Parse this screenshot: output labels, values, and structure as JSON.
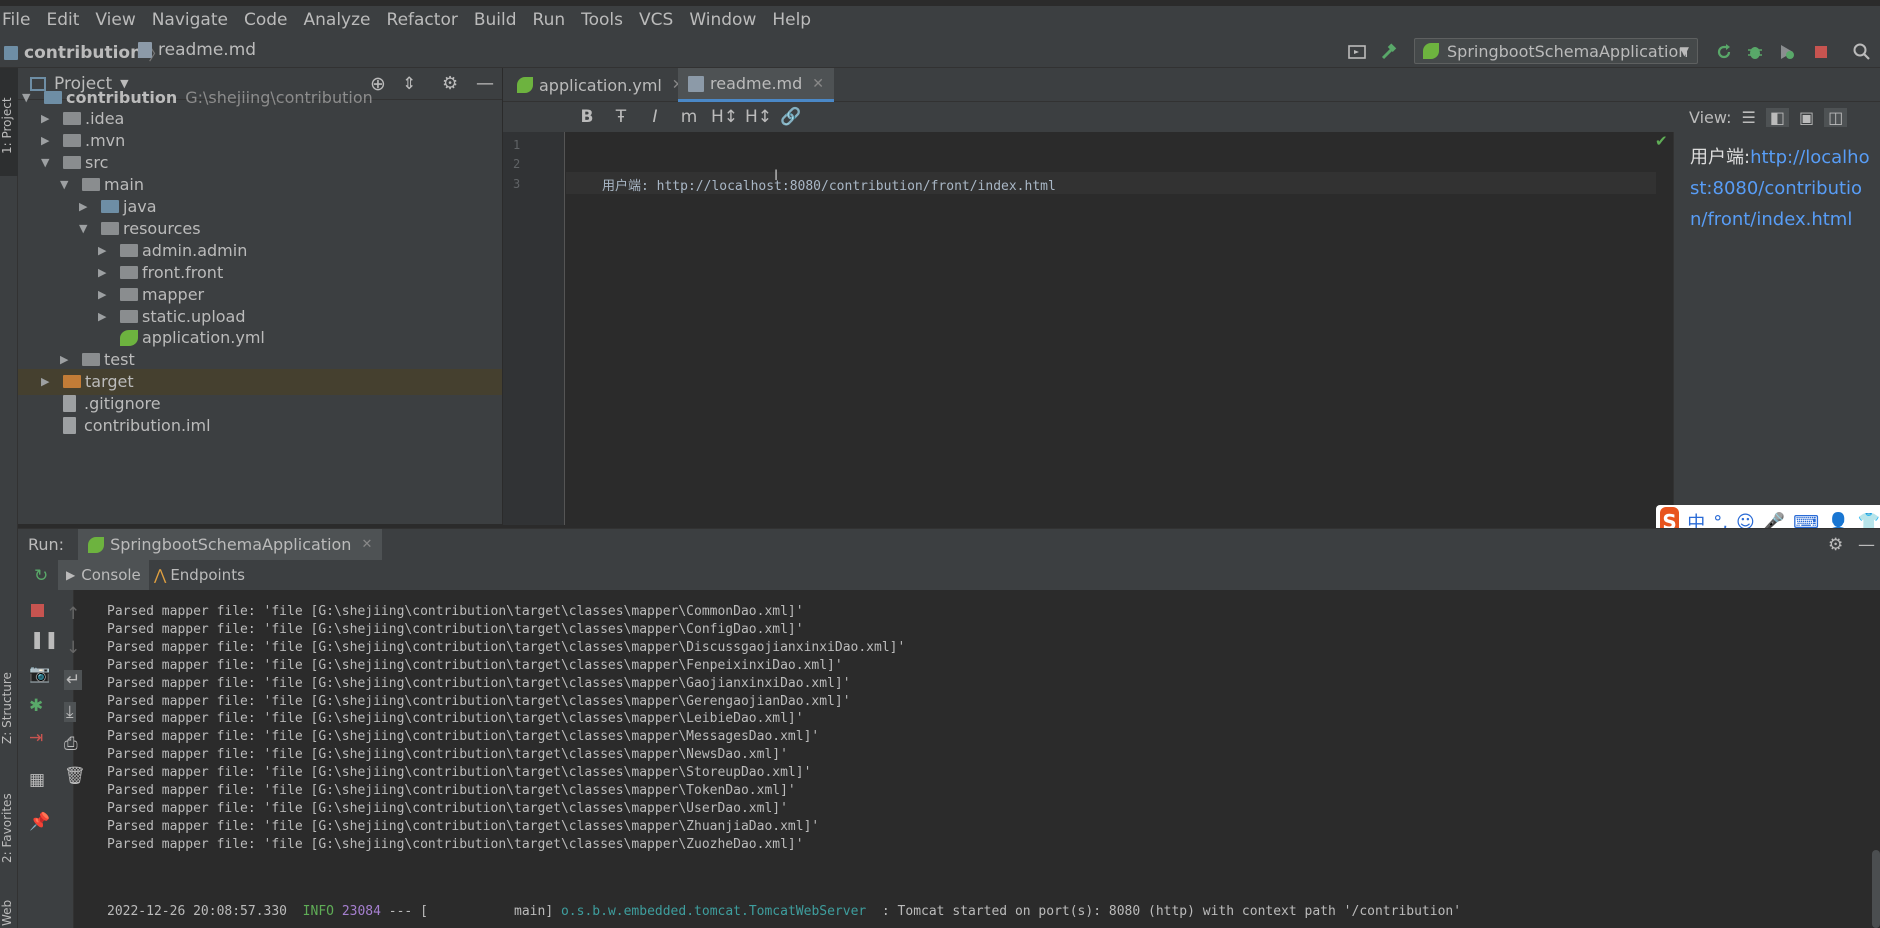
{
  "menu": [
    "File",
    "Edit",
    "View",
    "Navigate",
    "Code",
    "Analyze",
    "Refactor",
    "Build",
    "Run",
    "Tools",
    "VCS",
    "Window",
    "Help"
  ],
  "breadcrumb": {
    "project": "contribution",
    "file": "readme.md"
  },
  "run_config": "SpringbootSchemaApplication",
  "left_stripe": {
    "project": "1: Project",
    "structure": "Z: Structure",
    "favorites": "2: Favorites",
    "web": "Web"
  },
  "project_panel": {
    "title": "Project",
    "tree": [
      {
        "label": "contribution",
        "path": "G:\\shejiing\\contribution",
        "arrow": "▼",
        "indent": 0,
        "kind": "module"
      },
      {
        "label": ".idea",
        "arrow": "▶",
        "indent": 1,
        "kind": "gray"
      },
      {
        "label": ".mvn",
        "arrow": "▶",
        "indent": 1,
        "kind": "gray"
      },
      {
        "label": "src",
        "arrow": "▼",
        "indent": 1,
        "kind": "gray"
      },
      {
        "label": "main",
        "arrow": "▼",
        "indent": 2,
        "kind": "gray"
      },
      {
        "label": "java",
        "arrow": "▶",
        "indent": 3,
        "kind": "blue"
      },
      {
        "label": "resources",
        "arrow": "▼",
        "indent": 3,
        "kind": "res"
      },
      {
        "label": "admin.admin",
        "arrow": "▶",
        "indent": 4,
        "kind": "gray"
      },
      {
        "label": "front.front",
        "arrow": "▶",
        "indent": 4,
        "kind": "gray"
      },
      {
        "label": "mapper",
        "arrow": "▶",
        "indent": 4,
        "kind": "gray"
      },
      {
        "label": "static.upload",
        "arrow": "▶",
        "indent": 4,
        "kind": "gray"
      },
      {
        "label": "application.yml",
        "arrow": "",
        "indent": 4,
        "kind": "yml"
      },
      {
        "label": "test",
        "arrow": "▶",
        "indent": 2,
        "kind": "gray"
      },
      {
        "label": "target",
        "arrow": "▶",
        "indent": 1,
        "kind": "orange"
      },
      {
        "label": ".gitignore",
        "arrow": "",
        "indent": 1,
        "kind": "file"
      },
      {
        "label": "contribution.iml",
        "arrow": "",
        "indent": 1,
        "kind": "file"
      }
    ]
  },
  "editor": {
    "tabs": [
      "application.yml",
      "readme.md"
    ],
    "line_numbers": [
      "1",
      "2",
      "3"
    ],
    "code_line_3": "用户端: http://localhost:8080/contribution/front/index.html",
    "view_label": "View:",
    "preview_prefix": "用户端:",
    "preview_link": "http://localhost:8080/contribution/front/index.html"
  },
  "md_toolbar": [
    "B",
    "Ŧ",
    "I",
    "m",
    "H↕",
    "H↕",
    "🔗"
  ],
  "ime": {
    "logo": "S",
    "items": [
      "中",
      "°,",
      "☺",
      "🎤",
      "⌨",
      "👤",
      "👕"
    ]
  },
  "run_panel": {
    "label": "Run:",
    "config_tab": "SpringbootSchemaApplication",
    "tabs": [
      "Console",
      "Endpoints"
    ],
    "console_lines": [
      "Parsed mapper file: 'file [G:\\shejiing\\contribution\\target\\classes\\mapper\\CommonDao.xml]'",
      "Parsed mapper file: 'file [G:\\shejiing\\contribution\\target\\classes\\mapper\\ConfigDao.xml]'",
      "Parsed mapper file: 'file [G:\\shejiing\\contribution\\target\\classes\\mapper\\DiscussgaojianxinxiDao.xml]'",
      "Parsed mapper file: 'file [G:\\shejiing\\contribution\\target\\classes\\mapper\\FenpeixinxiDao.xml]'",
      "Parsed mapper file: 'file [G:\\shejiing\\contribution\\target\\classes\\mapper\\GaojianxinxiDao.xml]'",
      "Parsed mapper file: 'file [G:\\shejiing\\contribution\\target\\classes\\mapper\\GerengaojianDao.xml]'",
      "Parsed mapper file: 'file [G:\\shejiing\\contribution\\target\\classes\\mapper\\LeibieDao.xml]'",
      "Parsed mapper file: 'file [G:\\shejiing\\contribution\\target\\classes\\mapper\\MessagesDao.xml]'",
      "Parsed mapper file: 'file [G:\\shejiing\\contribution\\target\\classes\\mapper\\NewsDao.xml]'",
      "Parsed mapper file: 'file [G:\\shejiing\\contribution\\target\\classes\\mapper\\StoreupDao.xml]'",
      "Parsed mapper file: 'file [G:\\shejiing\\contribution\\target\\classes\\mapper\\TokenDao.xml]'",
      "Parsed mapper file: 'file [G:\\shejiing\\contribution\\target\\classes\\mapper\\UserDao.xml]'",
      "Parsed mapper file: 'file [G:\\shejiing\\contribution\\target\\classes\\mapper\\ZhuanjiaDao.xml]'",
      "Parsed mapper file: 'file [G:\\shejiing\\contribution\\target\\classes\\mapper\\ZuozheDao.xml]'"
    ],
    "last_line": {
      "timestamp": "2022-12-26 20:08:57.330",
      "level": "INFO",
      "pid": "23084",
      "sep": "--- [",
      "thread": "main]",
      "logger": "o.s.b.w.embedded.tomcat.TomcatWebServer",
      "message": ": Tomcat started on port(s): 8080 (http) with context path '/contribution'"
    }
  },
  "colors": {
    "accent": "#4a88c7",
    "link": "#589df6",
    "run_green": "#59a869",
    "stop_red": "#c75450"
  }
}
